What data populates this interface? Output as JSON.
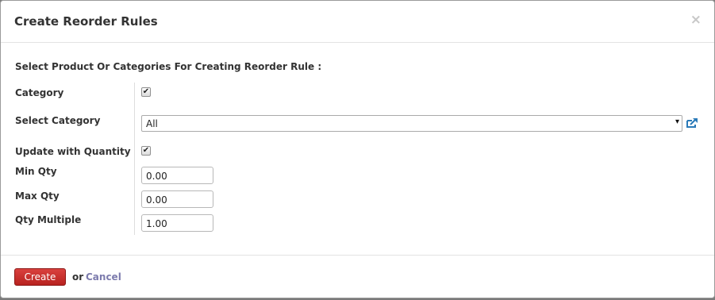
{
  "dialog": {
    "title": "Create Reorder Rules",
    "close_label": "×"
  },
  "form": {
    "intro": "Select Product Or Categories For Creating Reorder Rule :",
    "category": {
      "label": "Category",
      "checked": true,
      "check_glyph": "✔"
    },
    "select_category": {
      "label": "Select Category",
      "value": "All",
      "arrow_glyph": "▾",
      "icon": "external-link-icon"
    },
    "update_with_quantity": {
      "label": "Update with Quantity",
      "checked": true,
      "check_glyph": "✔"
    },
    "min_qty": {
      "label": "Min Qty",
      "value": "0.00"
    },
    "max_qty": {
      "label": "Max Qty",
      "value": "0.00"
    },
    "qty_multiple": {
      "label": "Qty Multiple",
      "value": "1.00"
    }
  },
  "footer": {
    "create_label": "Create",
    "or_text": "or",
    "cancel_label": "Cancel"
  },
  "colors": {
    "primary_button": "#c9302c",
    "link": "#7c7bad",
    "icon_blue": "#2a7ab8"
  }
}
